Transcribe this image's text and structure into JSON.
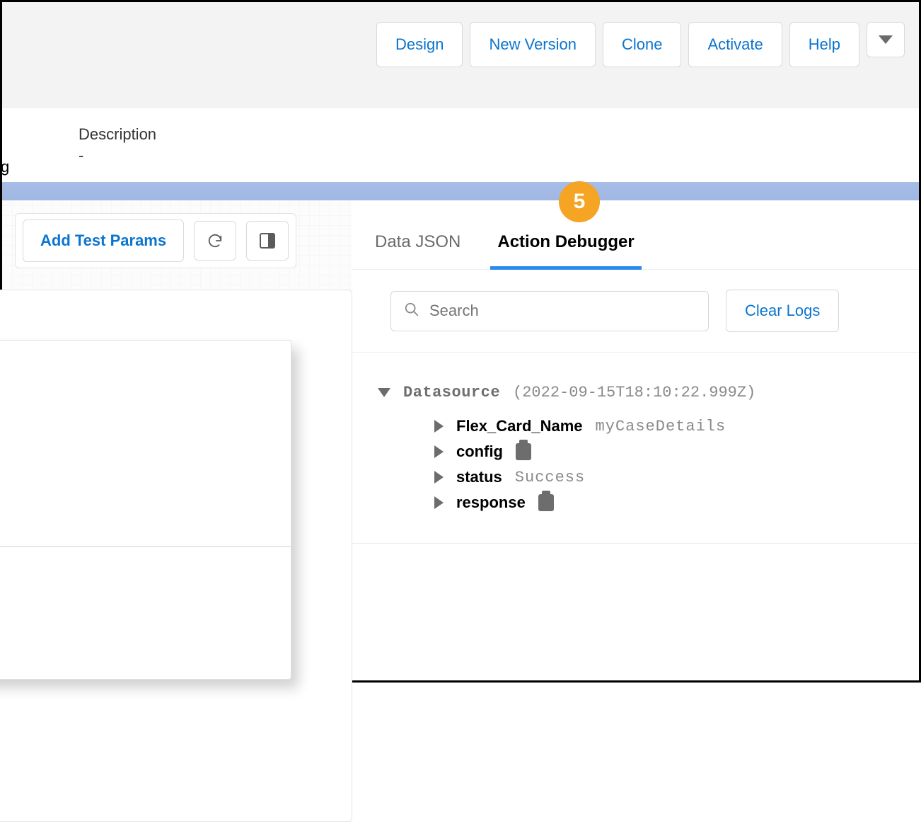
{
  "topbar": {
    "design": "Design",
    "new_version": "New Version",
    "clone": "Clone",
    "activate": "Activate",
    "help": "Help"
  },
  "meta": {
    "description_label": "Description",
    "description_value": "-",
    "left_clip": "g"
  },
  "left": {
    "add_test_params": "Add Test Params"
  },
  "callout": {
    "number": "5"
  },
  "tabs": {
    "data_json": "Data JSON",
    "action_debugger": "Action Debugger"
  },
  "search": {
    "placeholder": "Search",
    "clear_logs": "Clear Logs"
  },
  "log": {
    "datasource_label": "Datasource",
    "datasource_time": "(2022-09-15T18:10:22.999Z)",
    "rows": [
      {
        "key": "Flex_Card_Name",
        "val": "myCaseDetails",
        "icon": "none"
      },
      {
        "key": "config",
        "val": "",
        "icon": "clipboard"
      },
      {
        "key": "status",
        "val": "Success",
        "icon": "none"
      },
      {
        "key": "response",
        "val": "",
        "icon": "clipboard"
      }
    ]
  }
}
